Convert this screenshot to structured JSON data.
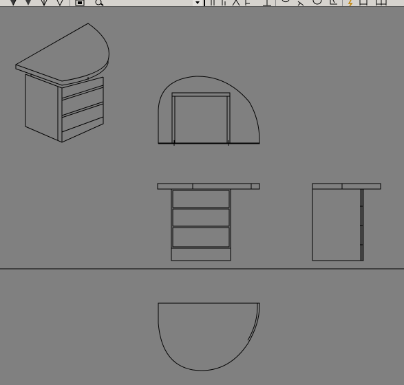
{
  "app": {
    "toolbar": {
      "left_icons": [
        "shaded-cube-icon",
        "shaded-cube-icon",
        "wire-cube-icon",
        "hidden-cube-icon",
        "camera-box-icon",
        "zoom-icon"
      ],
      "right_icons": [
        "dropdown-arrow-icon",
        "dimension-vertical-icon",
        "dimension-vertical-icon",
        "dimension-aligned-icon",
        "dimension-baseline-icon",
        "dimension-radius-icon",
        "dimension-angle-icon",
        "dimension-diameter-icon",
        "dimension-leader-icon",
        "snap-quick-icon",
        "dimension-linear-icon",
        "dimension-continue-icon"
      ]
    },
    "colors": {
      "background": "#808080",
      "toolbar": "#d6d3ce",
      "lines": "#000000"
    },
    "drawing": {
      "views": [
        "isometric-view",
        "side-elevation-view",
        "front-elevation-view",
        "right-elevation-view",
        "plan-view"
      ],
      "drawer_count": 3
    }
  }
}
